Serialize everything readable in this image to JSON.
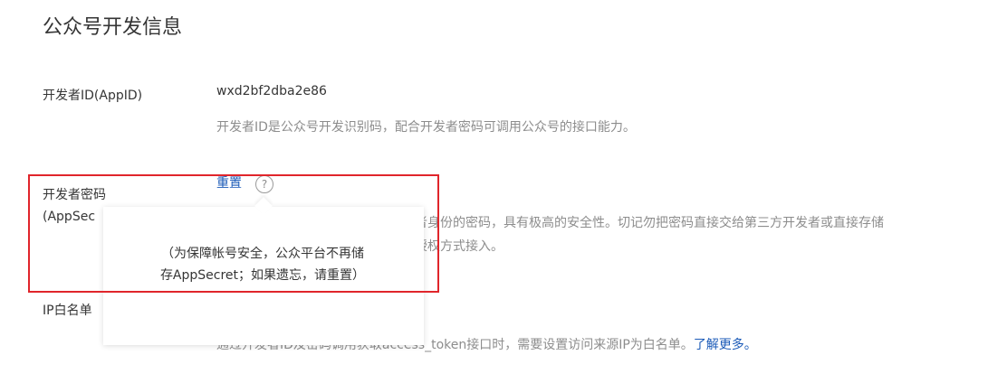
{
  "page": {
    "title": "公众号开发信息"
  },
  "appid": {
    "label": "开发者ID(AppID)",
    "value": "wxd2bf2dba2e86",
    "description": "开发者ID是公众号开发识别码，配合开发者密码可调用公众号的接口能力。"
  },
  "appsecret": {
    "label_line1": "开发者密码",
    "label_line2_partial": "(AppSec",
    "reset_label": "重置",
    "help_icon": "?",
    "description_partial_line1": "者身份的密码，具有极高的安全性。切记勿把密码直接交给第三方开发者或直接存储",
    "description_partial_line2": "授权方式接入。"
  },
  "tooltip": {
    "line1": "（为保障帐号安全，公众平台不再储",
    "line2": "存AppSecret；如果遗忘，请重置）"
  },
  "ip_whitelist": {
    "label_partial": "IP白名单",
    "description_partial": "通过开发者ID及密码调用获取access_token接口时，需要设置访问来源IP为白名单。",
    "learn_more": "了解更多。"
  },
  "colors": {
    "highlight_border": "#e0252b",
    "link": "#1c5bb8",
    "secondary_text": "#8d8d8d"
  }
}
